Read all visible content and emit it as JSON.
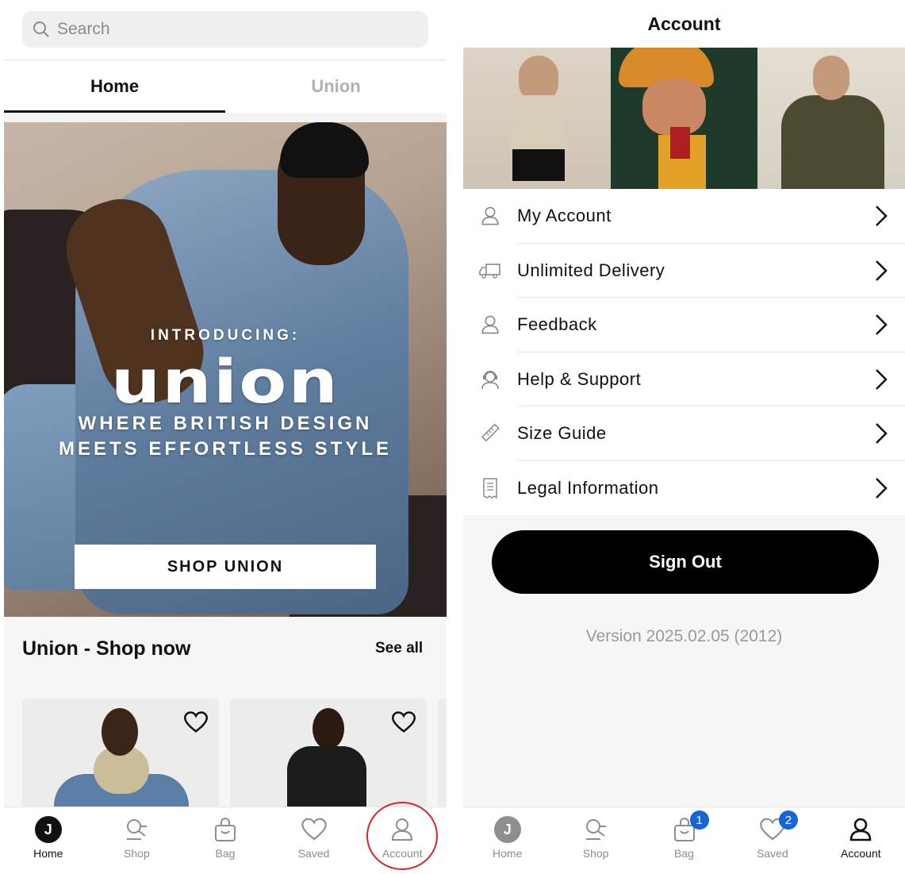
{
  "left": {
    "search": {
      "placeholder": "Search"
    },
    "tabs": [
      {
        "label": "Home",
        "active": true
      },
      {
        "label": "Union",
        "active": false
      }
    ],
    "hero": {
      "intro": "INTRODUCING:",
      "logo": "union",
      "tagline_line1": "WHERE BRITISH DESIGN",
      "tagline_line2": "MEETS EFFORTLESS STYLE",
      "button": "SHOP UNION"
    },
    "section": {
      "title": "Union - Shop now",
      "see_all": "See all"
    },
    "nav": [
      {
        "label": "Home",
        "icon": "j-logo-icon",
        "active": true
      },
      {
        "label": "Shop",
        "icon": "shop-search-icon",
        "active": false
      },
      {
        "label": "Bag",
        "icon": "bag-icon",
        "active": false
      },
      {
        "label": "Saved",
        "icon": "heart-icon",
        "active": false
      },
      {
        "label": "Account",
        "icon": "person-icon",
        "active": false
      }
    ],
    "jlogo_letter": "J"
  },
  "right": {
    "header": "Account",
    "menu": [
      {
        "label": "My Account",
        "icon": "person-icon"
      },
      {
        "label": "Unlimited Delivery",
        "icon": "truck-icon"
      },
      {
        "label": "Feedback",
        "icon": "person-icon"
      },
      {
        "label": "Help & Support",
        "icon": "support-agent-icon"
      },
      {
        "label": "Size Guide",
        "icon": "ruler-icon"
      },
      {
        "label": "Legal Information",
        "icon": "receipt-icon"
      }
    ],
    "sign_out": "Sign Out",
    "version": "Version 2025.02.05 (2012)",
    "nav": [
      {
        "label": "Home",
        "icon": "j-logo-icon",
        "active": false
      },
      {
        "label": "Shop",
        "icon": "shop-search-icon",
        "active": false
      },
      {
        "label": "Bag",
        "icon": "bag-icon",
        "active": false,
        "badge": "1"
      },
      {
        "label": "Saved",
        "icon": "heart-icon",
        "active": false,
        "badge": "2"
      },
      {
        "label": "Account",
        "icon": "person-icon",
        "active": true
      }
    ],
    "jlogo_letter": "J"
  },
  "colors": {
    "badge": "#1665d8",
    "highlight_circle": "#d3262b",
    "primary": "#000000"
  }
}
